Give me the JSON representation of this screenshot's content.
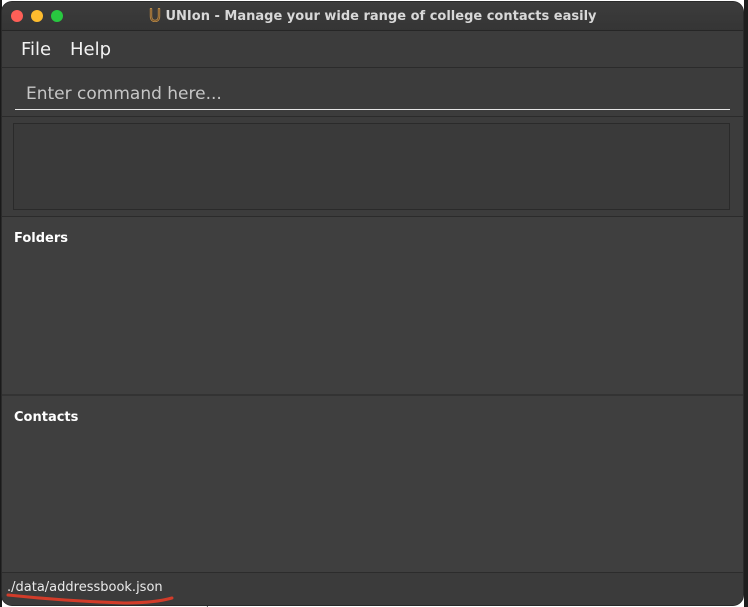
{
  "window": {
    "title": "UNIon - Manage your wide range of college contacts easily",
    "app_icon": "horseshoe-icon"
  },
  "menu": {
    "file_label": "File",
    "help_label": "Help"
  },
  "command": {
    "placeholder": "Enter command here...",
    "value": ""
  },
  "result": {
    "text": ""
  },
  "folders": {
    "title": "Folders"
  },
  "contacts": {
    "title": "Contacts"
  },
  "status": {
    "save_path": "./data/addressbook.json"
  },
  "colors": {
    "close": "#fe5f57",
    "minimize": "#febc2e",
    "maximize": "#28c840",
    "panel_bg": "#3f3f3f",
    "annotation": "#d23c2a"
  }
}
